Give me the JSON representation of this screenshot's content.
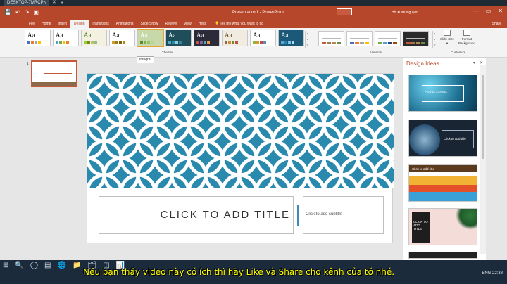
{
  "browser": {
    "tab_label": "DESKTOP-7MRCPN",
    "close": "✕",
    "new_tab": "+"
  },
  "window": {
    "title": "Presentation1 - PowerPoint",
    "user": "Hồ Xuân Nguyên",
    "qat": [
      "💾",
      "↶",
      "↷",
      "▣"
    ],
    "controls": [
      "—",
      "▭",
      "✕"
    ]
  },
  "tabs": [
    {
      "label": "File"
    },
    {
      "label": "Home"
    },
    {
      "label": "Insert"
    },
    {
      "label": "Design",
      "active": true
    },
    {
      "label": "Transitions"
    },
    {
      "label": "Animations"
    },
    {
      "label": "Slide Show"
    },
    {
      "label": "Review"
    },
    {
      "label": "View"
    },
    {
      "label": "Help"
    }
  ],
  "tell_me": "💡 Tell me what you want to do",
  "share": "Share",
  "ribbon": {
    "themes_label": "Themes",
    "variants_label": "Variants",
    "customize_label": "Customize",
    "theme_sample": "Aa",
    "slide_size": "Slide Size ▾",
    "format_background": "Format Background",
    "tooltip": "Integral",
    "themes": [
      {
        "bg": "#ffffff",
        "fg": "#000000",
        "colors": [
          "#4472c4",
          "#ed7d31",
          "#a5a5a5",
          "#ffc000"
        ]
      },
      {
        "bg": "#ffffff",
        "fg": "#000000",
        "colors": [
          "#5b9bd5",
          "#70ad47",
          "#ffc000",
          "#ed7d31"
        ]
      },
      {
        "bg": "#f4f1e1",
        "fg": "#3c6e1e",
        "colors": [
          "#9acd32",
          "#6b8e23",
          "#c0c060",
          "#8fbc8f"
        ]
      },
      {
        "bg": "#ffffff",
        "fg": "#000000",
        "colors": [
          "#c8a02d",
          "#9e7a17",
          "#7f6010",
          "#b8860b"
        ]
      },
      {
        "bg": "#c7d9a8",
        "fg": "#ffffff",
        "colors": [
          "#5b8a33",
          "#7ab04c",
          "#96c46a",
          "#b6d88e"
        ]
      },
      {
        "bg": "#1f4e5a",
        "fg": "#ffffff",
        "colors": [
          "#4bacc6",
          "#2e8ba8",
          "#92cddc",
          "#31859c"
        ]
      },
      {
        "bg": "#2b2b3a",
        "fg": "#ffffff",
        "colors": [
          "#c0504d",
          "#8064a2",
          "#4bacc6",
          "#f79646"
        ]
      },
      {
        "bg": "#f2ece0",
        "fg": "#5a3e1b",
        "colors": [
          "#8a6a4a",
          "#c98e3a",
          "#6e8b3d",
          "#b5554a"
        ]
      },
      {
        "bg": "#ffffff",
        "fg": "#000000",
        "colors": [
          "#94b43c",
          "#d39b2c",
          "#c44e3a",
          "#5b8db8"
        ]
      },
      {
        "bg": "#1a5a78",
        "fg": "#ffffff",
        "colors": [
          "#59a5d8",
          "#2b7fae",
          "#7ec7e6",
          "#b0dbee"
        ]
      }
    ],
    "variants": [
      {
        "bg": "#ffffff",
        "colors": [
          "#c55a38",
          "#9e7a4a",
          "#ad8a56",
          "#6b8b47"
        ]
      },
      {
        "bg": "#ffffff",
        "colors": [
          "#4472c4",
          "#ed7d31",
          "#a5a5a5",
          "#ffc000"
        ]
      },
      {
        "bg": "#ffffff",
        "colors": [
          "#70ad47",
          "#5b9bd5",
          "#264478",
          "#9e480e"
        ]
      },
      {
        "bg": "#2a2a2a",
        "colors": [
          "#c55a38",
          "#9e7a4a",
          "#ad8a56",
          "#6b8b47"
        ]
      }
    ]
  },
  "thumbnail": {
    "number": "1"
  },
  "slide": {
    "title_placeholder": "CLICK TO ADD TITLE",
    "subtitle_placeholder": "Click to add subtitle",
    "pattern_bg": "#2a8aae",
    "pattern_fg": "#ffffff"
  },
  "design_ideas": {
    "title": "Design Ideas",
    "header_buttons": [
      "▾",
      "✕"
    ],
    "items": [
      {
        "label": "Click to add title",
        "bg": "#1a6a8c"
      },
      {
        "label": "Click to add title",
        "bg": "#1a2533"
      },
      {
        "label": "Click to add title",
        "bg": "#ffffff"
      },
      {
        "label": "CLICK TO ADD TITLE",
        "bg": "#f4dcd8"
      },
      {
        "label": "",
        "bg": "#222222"
      }
    ]
  },
  "taskbar": {
    "icons": [
      "⊞",
      "🔍",
      "◯",
      "▤",
      "🌐",
      "📁",
      "🗂",
      "◫",
      "📊"
    ],
    "tray": "ENG  22:38"
  },
  "caption": "Nếu bạn thấy video này có ích thì hãy Like và Share cho kênh của tớ nhé."
}
